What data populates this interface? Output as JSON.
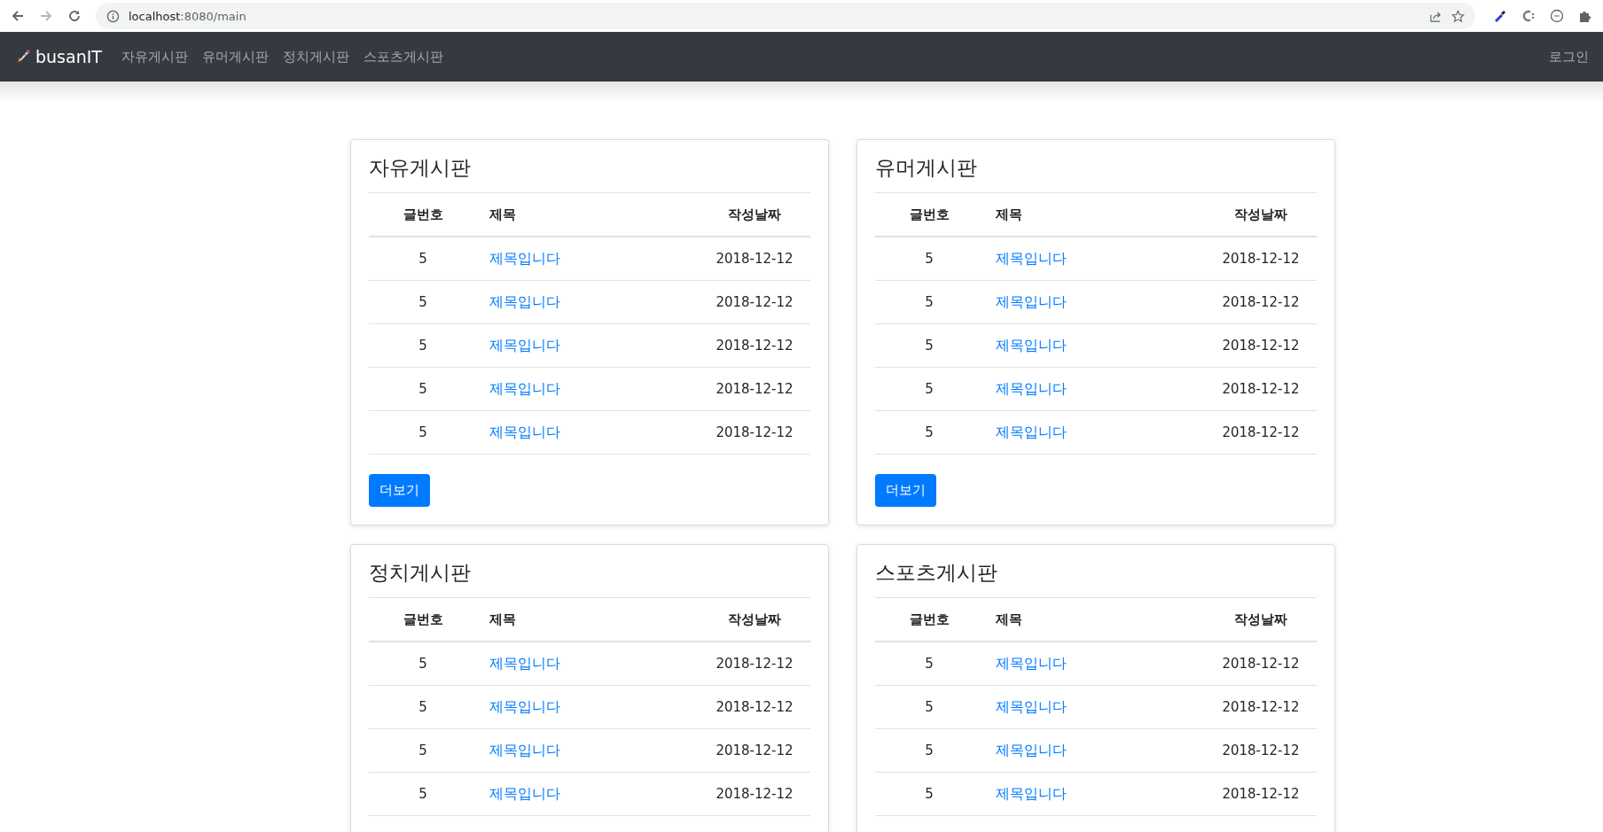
{
  "browser": {
    "url_host": "localhost",
    "url_path": ":8080/main"
  },
  "navbar": {
    "brand": "busanIT",
    "links": [
      "자유게시판",
      "유머게시판",
      "정치게시판",
      "스포츠게시판"
    ],
    "login": "로그인"
  },
  "boards": [
    {
      "title": "자유게시판",
      "columns": [
        "글번호",
        "제목",
        "작성날짜"
      ],
      "rows": [
        {
          "number": "5",
          "title": "제목입니다",
          "date": "2018-12-12"
        },
        {
          "number": "5",
          "title": "제목입니다",
          "date": "2018-12-12"
        },
        {
          "number": "5",
          "title": "제목입니다",
          "date": "2018-12-12"
        },
        {
          "number": "5",
          "title": "제목입니다",
          "date": "2018-12-12"
        },
        {
          "number": "5",
          "title": "제목입니다",
          "date": "2018-12-12"
        }
      ],
      "more_button": "더보기"
    },
    {
      "title": "유머게시판",
      "columns": [
        "글번호",
        "제목",
        "작성날짜"
      ],
      "rows": [
        {
          "number": "5",
          "title": "제목입니다",
          "date": "2018-12-12"
        },
        {
          "number": "5",
          "title": "제목입니다",
          "date": "2018-12-12"
        },
        {
          "number": "5",
          "title": "제목입니다",
          "date": "2018-12-12"
        },
        {
          "number": "5",
          "title": "제목입니다",
          "date": "2018-12-12"
        },
        {
          "number": "5",
          "title": "제목입니다",
          "date": "2018-12-12"
        }
      ],
      "more_button": "더보기"
    },
    {
      "title": "정치게시판",
      "columns": [
        "글번호",
        "제목",
        "작성날짜"
      ],
      "rows": [
        {
          "number": "5",
          "title": "제목입니다",
          "date": "2018-12-12"
        },
        {
          "number": "5",
          "title": "제목입니다",
          "date": "2018-12-12"
        },
        {
          "number": "5",
          "title": "제목입니다",
          "date": "2018-12-12"
        },
        {
          "number": "5",
          "title": "제목입니다",
          "date": "2018-12-12"
        }
      ]
    },
    {
      "title": "스포츠게시판",
      "columns": [
        "글번호",
        "제목",
        "작성날짜"
      ],
      "rows": [
        {
          "number": "5",
          "title": "제목입니다",
          "date": "2018-12-12"
        },
        {
          "number": "5",
          "title": "제목입니다",
          "date": "2018-12-12"
        },
        {
          "number": "5",
          "title": "제목입니다",
          "date": "2018-12-12"
        },
        {
          "number": "5",
          "title": "제목입니다",
          "date": "2018-12-12"
        }
      ]
    }
  ]
}
